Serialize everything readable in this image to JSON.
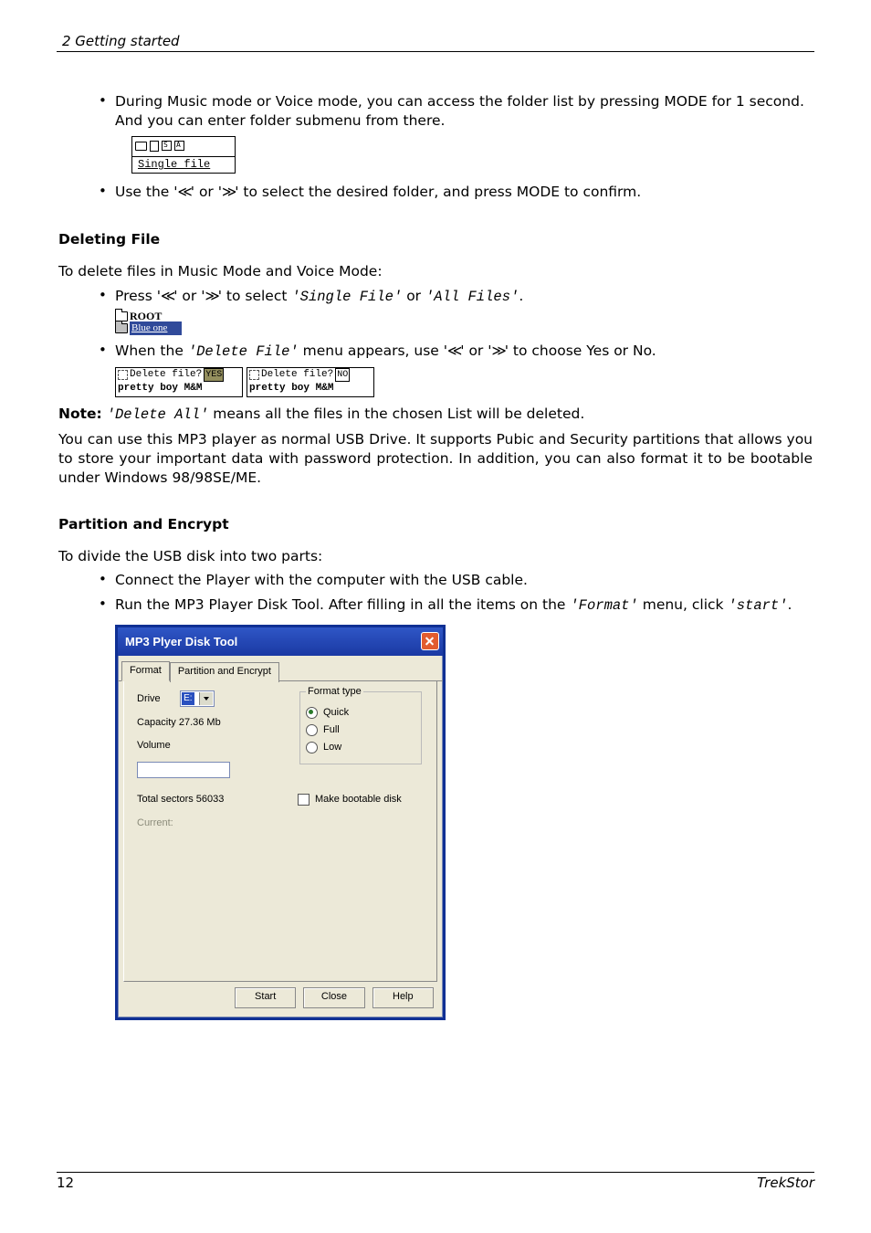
{
  "header": {
    "section": "2 Getting started"
  },
  "body": {
    "bullet1": "During Music mode or Voice mode, you can access the folder list by pressing MODE for 1 second. And you can enter folder submenu from there.",
    "lcd1_line": "Single file",
    "bullet2_pre": "Use the '",
    "bullet2_mid1": "≪",
    "bullet2_mid2": "' or '",
    "bullet2_mid3": "≫",
    "bullet2_post": "' to select the desired folder, and press MODE to confirm.",
    "h_delete": "Deleting File",
    "p_delete_intro": "To delete files in Music Mode and Voice Mode:",
    "b_del1_a": "Press '",
    "b_del1_b": "' or '",
    "b_del1_c": "' to select ",
    "b_del1_d": "'Single File'",
    "b_del1_e": " or ",
    "b_del1_f": "'All Files'",
    "b_del1_g": ".",
    "lcd2_root": "ROOT",
    "lcd2_sel": "Blue one",
    "b_del2_a": "When the ",
    "b_del2_b": "'Delete File'",
    "b_del2_c": " menu appears, use '",
    "b_del2_d": "' or '",
    "b_del2_e": "' to choose Yes or No.",
    "delbox_q": "Delete file?",
    "delbox_yes": "YES",
    "delbox_no": "NO",
    "delbox_song": "pretty boy M&M",
    "note_label": "Note:",
    "note_code": "'Delete All'",
    "note_rest": " means all the files in the chosen List will be deleted.",
    "p_usb": "You can use this MP3 player as normal USB Drive. It supports Pubic and Security partitions that allows you to store your important data with password protection. In addition, you can also format it to be bootable under Windows 98/98SE/ME.",
    "h_partition": "Partition and Encrypt",
    "p_part_intro": "To divide the USB disk into two parts:",
    "b_part1": "Connect the Player with the computer with the USB cable.",
    "b_part2_a": "Run the MP3 Player Disk Tool. After filling in all the items on the ",
    "b_part2_b": "'Format'",
    "b_part2_c": " menu, click ",
    "b_part2_d": "'start'",
    "b_part2_e": "."
  },
  "dialog": {
    "title": "MP3 Plyer Disk Tool",
    "tabs": {
      "format": "Format",
      "partition": "Partition and Encrypt"
    },
    "drive_label": "Drive",
    "drive_value": "E:",
    "capacity_label": "Capacity 27.36 Mb",
    "volume_label": "Volume",
    "sectors_label": "Total sectors 56033",
    "current_label": "Current:",
    "ft_legend": "Format type",
    "ft_quick": "Quick",
    "ft_full": "Full",
    "ft_low": "Low",
    "boot_label": "Make bootable disk",
    "btn_start": "Start",
    "btn_close": "Close",
    "btn_help": "Help"
  },
  "chart_data": {
    "type": "table",
    "title": "MP3 Plyer Disk Tool — Format tab",
    "fields": [
      {
        "label": "Drive",
        "value": "E:"
      },
      {
        "label": "Capacity",
        "value": "27.36 Mb"
      },
      {
        "label": "Volume",
        "value": ""
      },
      {
        "label": "Total sectors",
        "value": 56033
      },
      {
        "label": "Format type",
        "value": "Quick",
        "options": [
          "Quick",
          "Full",
          "Low"
        ]
      },
      {
        "label": "Make bootable disk",
        "value": false
      }
    ],
    "buttons": [
      "Start",
      "Close",
      "Help"
    ]
  },
  "footer": {
    "page": "12",
    "brand": "TrekStor"
  }
}
